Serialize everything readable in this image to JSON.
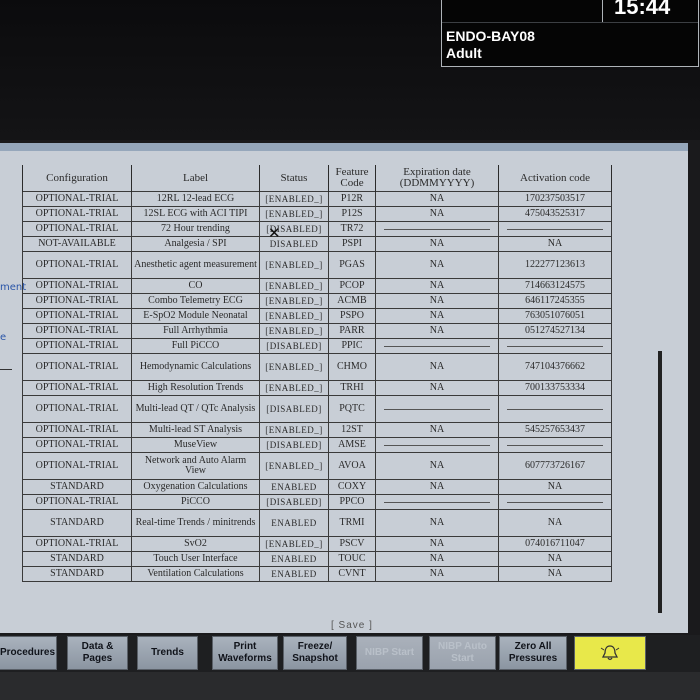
{
  "status": {
    "time": "15:44",
    "bed": "ENDO-BAY08",
    "patient_type": "Adult"
  },
  "side_fragments": [
    "ment",
    "e"
  ],
  "table": {
    "headers": [
      "Configuration",
      "Label",
      "Status",
      "Feature Code",
      "Expiration date (DDMMYYYY)",
      "Activation code"
    ],
    "rows": [
      {
        "config": "OPTIONAL-TRIAL",
        "label": "12RL 12-lead ECG",
        "status": "[ENABLED_]",
        "code": "P12R",
        "exp": "NA",
        "act": "170237503517"
      },
      {
        "config": "OPTIONAL-TRIAL",
        "label": "12SL ECG with ACI TIPI",
        "status": "[ENABLED_]",
        "code": "P12S",
        "exp": "NA",
        "act": "475043525317"
      },
      {
        "config": "OPTIONAL-TRIAL",
        "label": "72 Hour trending",
        "status": "[DISABLED]",
        "code": "TR72",
        "exp": "",
        "act": ""
      },
      {
        "config": "NOT-AVAILABLE",
        "label": "Analgesia / SPI",
        "status": "DISABLED",
        "code": "PSPI",
        "exp": "NA",
        "act": "NA"
      },
      {
        "config": "OPTIONAL-TRIAL",
        "label": "Anesthetic agent measurement",
        "status": "[ENABLED_]",
        "code": "PGAS",
        "exp": "NA",
        "act": "122277123613",
        "tall": true
      },
      {
        "config": "OPTIONAL-TRIAL",
        "label": "CO",
        "status": "[ENABLED_]",
        "code": "PCOP",
        "exp": "NA",
        "act": "714663124575"
      },
      {
        "config": "OPTIONAL-TRIAL",
        "label": "Combo Telemetry ECG",
        "status": "[ENABLED_]",
        "code": "ACMB",
        "exp": "NA",
        "act": "646117245355"
      },
      {
        "config": "OPTIONAL-TRIAL",
        "label": "E-SpO2 Module Neonatal",
        "status": "[ENABLED_]",
        "code": "PSPO",
        "exp": "NA",
        "act": "763051076051"
      },
      {
        "config": "OPTIONAL-TRIAL",
        "label": "Full Arrhythmia",
        "status": "[ENABLED_]",
        "code": "PARR",
        "exp": "NA",
        "act": "051274527134"
      },
      {
        "config": "OPTIONAL-TRIAL",
        "label": "Full PiCCO",
        "status": "[DISABLED]",
        "code": "PPIC",
        "exp": "",
        "act": ""
      },
      {
        "config": "OPTIONAL-TRIAL",
        "label": "Hemodynamic Calculations",
        "status": "[ENABLED_]",
        "code": "CHMO",
        "exp": "NA",
        "act": "747104376662",
        "tall": true
      },
      {
        "config": "OPTIONAL-TRIAL",
        "label": "High Resolution Trends",
        "status": "[ENABLED_]",
        "code": "TRHI",
        "exp": "NA",
        "act": "700133753334"
      },
      {
        "config": "OPTIONAL-TRIAL",
        "label": "Multi-lead QT / QTc Analysis",
        "status": "[DISABLED]",
        "code": "PQTC",
        "exp": "",
        "act": "",
        "tall": true
      },
      {
        "config": "OPTIONAL-TRIAL",
        "label": "Multi-lead ST Analysis",
        "status": "[ENABLED_]",
        "code": "12ST",
        "exp": "NA",
        "act": "545257653437"
      },
      {
        "config": "OPTIONAL-TRIAL",
        "label": "MuseView",
        "status": "[DISABLED]",
        "code": "AMSE",
        "exp": "",
        "act": ""
      },
      {
        "config": "OPTIONAL-TRIAL",
        "label": "Network and Auto Alarm View",
        "status": "[ENABLED_]",
        "code": "AVOA",
        "exp": "NA",
        "act": "607773726167",
        "tall": true
      },
      {
        "config": "STANDARD",
        "label": "Oxygenation Calculations",
        "status": "ENABLED",
        "code": "COXY",
        "exp": "NA",
        "act": "NA"
      },
      {
        "config": "OPTIONAL-TRIAL",
        "label": "PiCCO",
        "status": "[DISABLED]",
        "code": "PPCO",
        "exp": "",
        "act": ""
      },
      {
        "config": "STANDARD",
        "label": "Real-time Trends / minitrends",
        "status": "ENABLED",
        "code": "TRMI",
        "exp": "NA",
        "act": "NA",
        "tall": true
      },
      {
        "config": "OPTIONAL-TRIAL",
        "label": "SvO2",
        "status": "[ENABLED_]",
        "code": "PSCV",
        "exp": "NA",
        "act": "074016711047"
      },
      {
        "config": "STANDARD",
        "label": "Touch User Interface",
        "status": "ENABLED",
        "code": "TOUC",
        "exp": "NA",
        "act": "NA"
      },
      {
        "config": "STANDARD",
        "label": "Ventilation Calculations",
        "status": "ENABLED",
        "code": "CVNT",
        "exp": "NA",
        "act": "NA"
      }
    ],
    "save_label": "[ Save ]"
  },
  "buttons": [
    {
      "label": "Procedures",
      "state": "normal"
    },
    {
      "label": "Data & Pages",
      "state": "normal"
    },
    {
      "label": "Trends",
      "state": "normal"
    },
    {
      "label": "Print Waveforms",
      "state": "normal"
    },
    {
      "label": "Freeze/ Snapshot",
      "state": "normal"
    },
    {
      "label": "NIBP Start",
      "state": "disabled"
    },
    {
      "label": "NIBP Auto Start",
      "state": "disabled"
    },
    {
      "label": "Zero All Pressures",
      "state": "normal"
    },
    {
      "label": "",
      "state": "alarm",
      "icon": "alarm-bell-icon"
    }
  ]
}
